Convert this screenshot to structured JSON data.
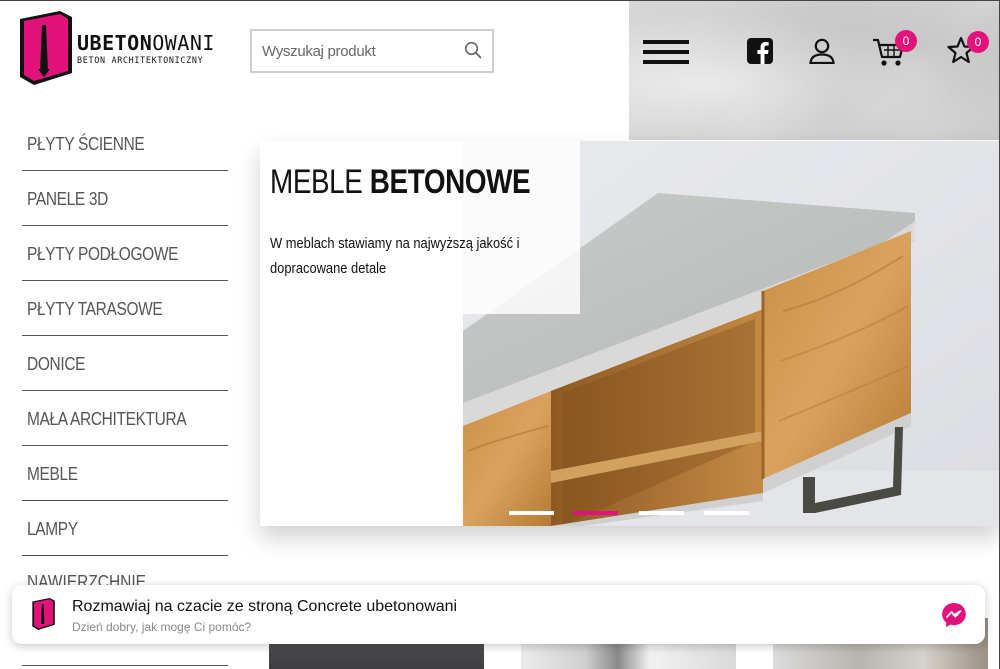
{
  "logo": {
    "name_bold": "UBETON",
    "name_light": "OWANI",
    "tagline": "BETON ARCHITEKTONICZNY"
  },
  "search": {
    "placeholder": "Wyszukaj produkt",
    "value": ""
  },
  "header": {
    "cart_count": "0",
    "wishlist_count": "0",
    "icons": [
      "menu-icon",
      "facebook-icon",
      "user-icon",
      "cart-icon",
      "star-icon"
    ]
  },
  "sidebar": {
    "items": [
      {
        "label": "PŁYTY ŚCIENNE"
      },
      {
        "label": "PANELE 3D"
      },
      {
        "label": "PŁYTY PODŁOGOWE"
      },
      {
        "label": "PŁYTY TARASOWE"
      },
      {
        "label": "DONICE"
      },
      {
        "label": "MAŁA ARCHITEKTURA"
      },
      {
        "label": "MEBLE"
      },
      {
        "label": "LAMPY"
      }
    ],
    "partial_item": "NAWIERZCHNIE"
  },
  "hero": {
    "title_light": "MEBLE",
    "title_bold": "BETONOWE",
    "text_line1": "W meblach stawiamy na najwyższą jakość i",
    "text_line2": "dopracowane detale",
    "slides": 4,
    "active_slide": 2
  },
  "chat": {
    "title": "Rozmawiaj na czacie ze stroną Concrete ubetonowani",
    "subtitle": "Dzień dobry, jak mogę Ci pomóc?"
  },
  "colors": {
    "accent": "#e2127a",
    "text": "#111111",
    "nav_text": "#555555"
  }
}
